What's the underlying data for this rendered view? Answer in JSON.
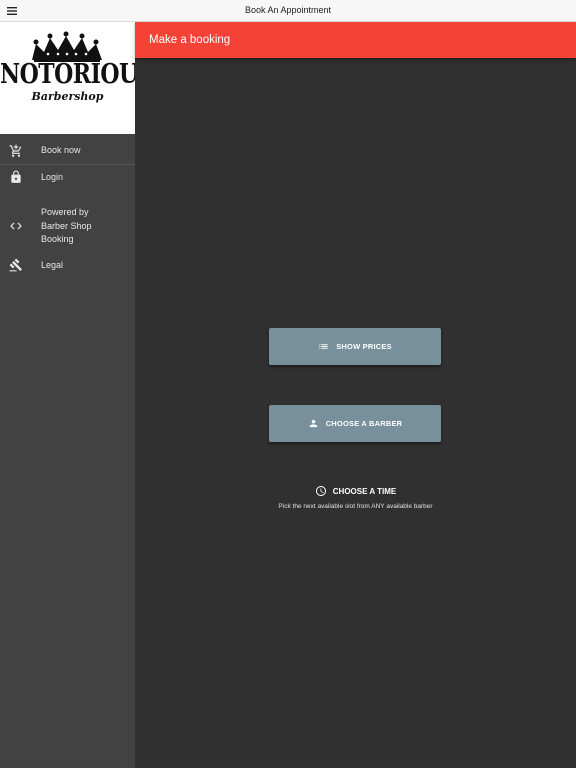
{
  "topbar": {
    "title": "Book An Appointment",
    "menu_icon": "hamburger-menu-icon"
  },
  "sidebar": {
    "logo": {
      "brand": "NOTORIOUS",
      "sub": "Barbershop",
      "icon": "crown-icon"
    },
    "items": [
      {
        "label": "Book now",
        "icon": "cart-add-icon"
      },
      {
        "label": "Login",
        "icon": "lock-icon"
      },
      {
        "label": "Powered by\nBarber Shop\nBooking",
        "icon": "code-icon"
      },
      {
        "label": "Legal",
        "icon": "gavel-icon"
      }
    ]
  },
  "main": {
    "header_title": "Make a booking",
    "show_prices_label": "SHOW PRICES",
    "choose_barber_label": "CHOOSE A BARBER",
    "choose_time_label": "CHOOSE A TIME",
    "choose_time_sub": "Pick the next available slot from ANY available barber"
  },
  "colors": {
    "header": "#f44336",
    "button": "#78909c",
    "sidebar": "#424242",
    "background": "#303030"
  }
}
